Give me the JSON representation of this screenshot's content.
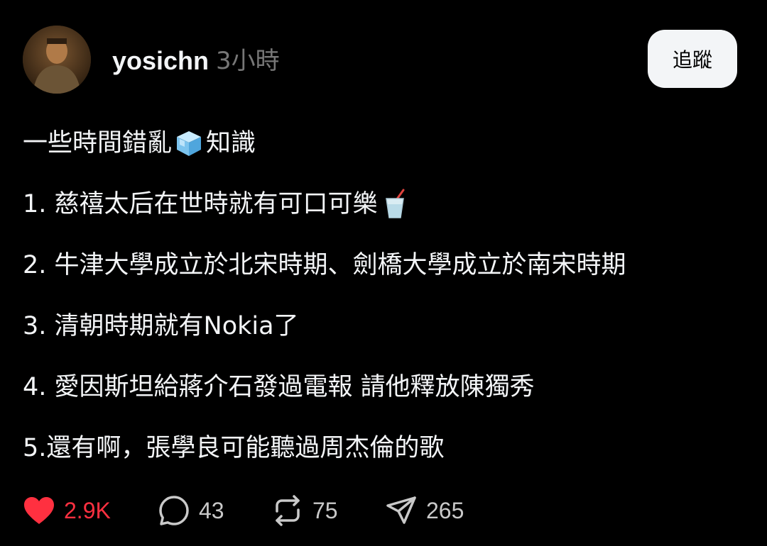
{
  "post": {
    "username": "yosichn",
    "time": "3小時",
    "follow_label": "追蹤",
    "lines": [
      {
        "before": "一些時間錯亂",
        "emoji": "ice-cube-icon",
        "after": "知識"
      },
      {
        "text": "1. 慈禧太后在世時就有可口可樂",
        "emoji": "cup-with-straw-icon"
      },
      {
        "text": "2. 牛津大學成立於北宋時期、劍橋大學成立於南宋時期"
      },
      {
        "text": "3. 清朝時期就有Nokia了"
      },
      {
        "text": "4. 愛因斯坦給蔣介石發過電報 請他釋放陳獨秀"
      },
      {
        "text": "5.還有啊，張學良可能聽過周杰倫的歌"
      }
    ]
  },
  "actions": {
    "likes": "2.9K",
    "comments": "43",
    "reposts": "75",
    "shares": "265",
    "like_color": "#ff3040"
  },
  "icons": {
    "like": "heart-icon",
    "comment": "comment-bubble-icon",
    "repost": "repost-icon",
    "share": "send-icon"
  }
}
